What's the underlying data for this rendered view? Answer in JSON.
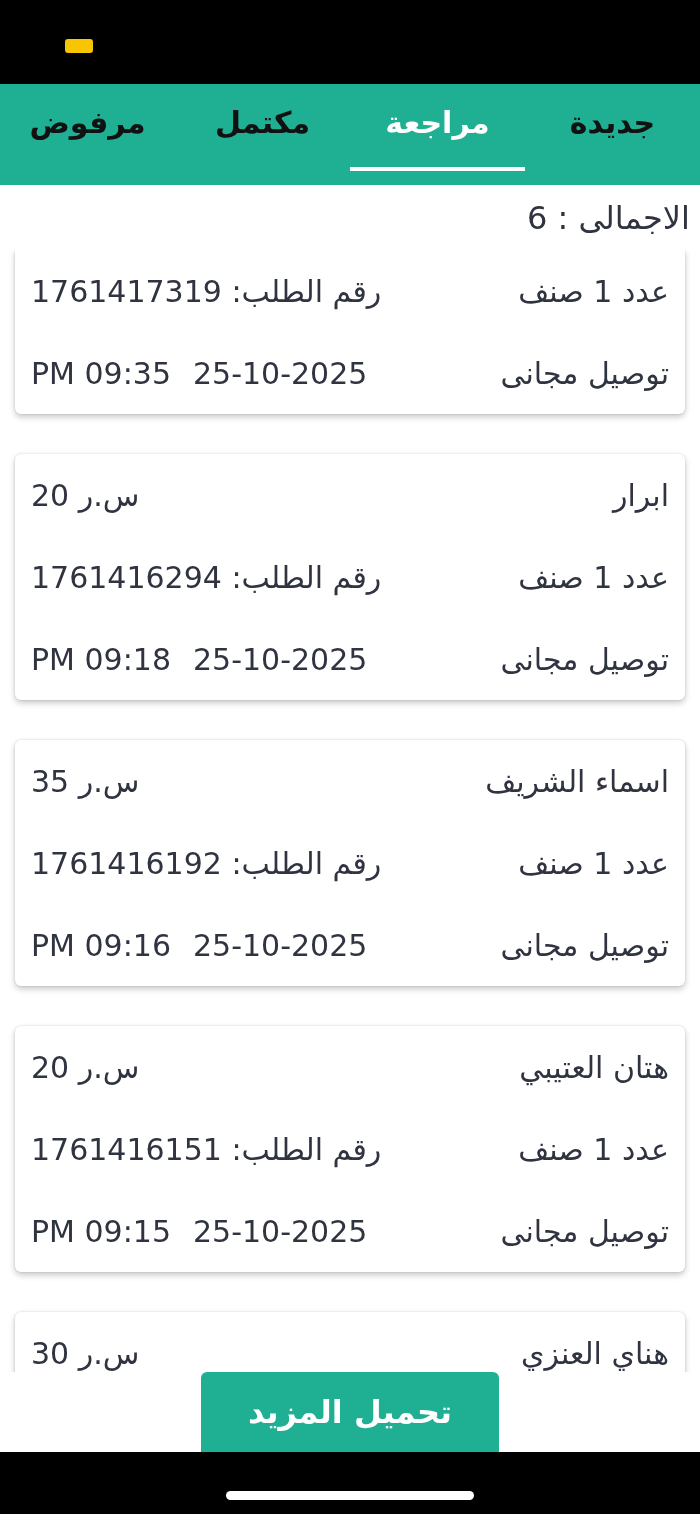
{
  "tabs": [
    {
      "label": "جديدة",
      "selected": false
    },
    {
      "label": "مراجعة",
      "selected": true
    },
    {
      "label": "مكتمل",
      "selected": false
    },
    {
      "label": "مرفوض",
      "selected": false
    }
  ],
  "total": "الاجمالى : 6",
  "orders": [
    {
      "items": "عدد 1 صنف",
      "order_number": "رقم الطلب: 1761417319",
      "delivery": "توصيل مجانى",
      "date": "25-10-2025",
      "time": "PM 09:35"
    },
    {
      "name": "ابرار",
      "price": "20 ر.س",
      "items": "عدد 1 صنف",
      "order_number": "رقم الطلب: 1761416294",
      "delivery": "توصيل مجانى",
      "date": "25-10-2025",
      "time": "PM 09:18"
    },
    {
      "name": "اسماء الشريف",
      "price": "35 ر.س",
      "items": "عدد 1 صنف",
      "order_number": "رقم الطلب: 1761416192",
      "delivery": "توصيل مجانى",
      "date": "25-10-2025",
      "time": "PM 09:16"
    },
    {
      "name": "هتان العتيبي",
      "price": "20 ر.س",
      "items": "عدد 1 صنف",
      "order_number": "رقم الطلب: 1761416151",
      "delivery": "توصيل مجانى",
      "date": "25-10-2025",
      "time": "PM 09:15"
    },
    {
      "name": "هناي العنزي",
      "price": "30 ر.س"
    }
  ],
  "load_more": "تحميل المزيد"
}
